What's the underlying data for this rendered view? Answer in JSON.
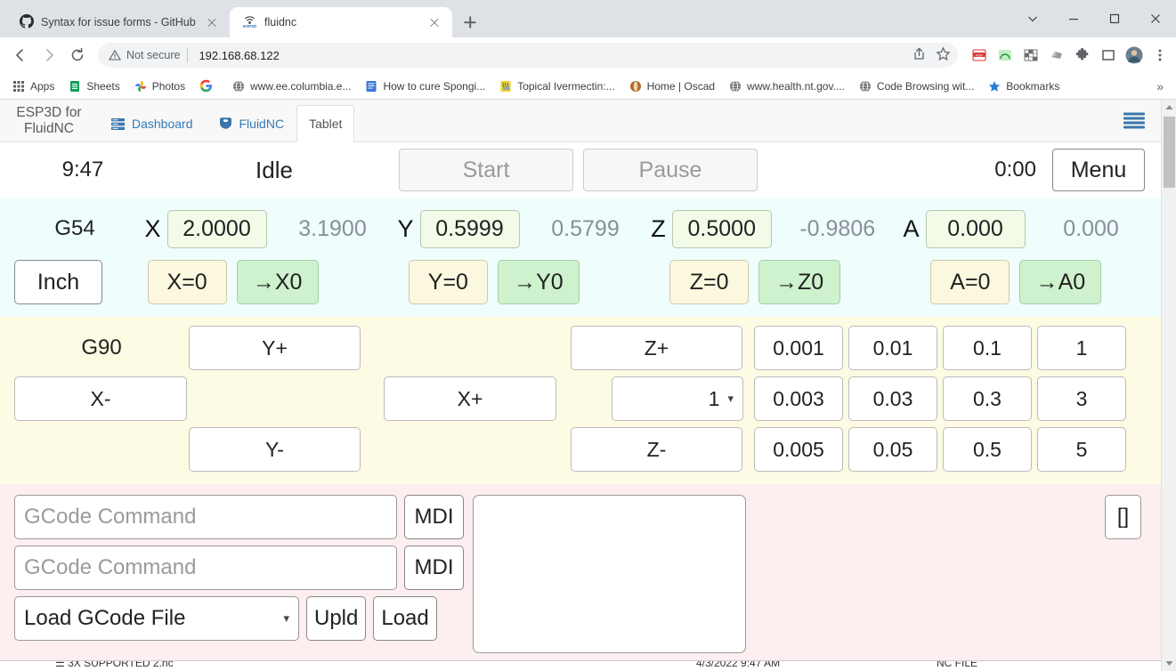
{
  "browser": {
    "tabs": [
      {
        "title": "Syntax for issue forms - GitHub D",
        "icon": "github-icon",
        "active": false
      },
      {
        "title": "fluidnc",
        "icon": "esp3d-favicon",
        "active": true
      }
    ],
    "newtab_label": "+",
    "nav": {
      "back": "back-arrow",
      "forward": "forward-arrow",
      "reload": "reload-icon"
    },
    "omnibox": {
      "security_label": "Not secure",
      "url": "192.168.68.122",
      "share_icon": "share-icon",
      "star_icon": "star-icon"
    },
    "toolbar_icons": [
      "pdf-extension-icon",
      "green-arc-extension-icon",
      "grid-extension-icon",
      "stone-extension-icon",
      "puzzle-extensions-icon",
      "sidepanel-icon",
      "profile-avatar",
      "three-dot-menu-icon"
    ],
    "bookmarks": [
      {
        "label": "Apps",
        "icon": "apps-grid-icon"
      },
      {
        "label": "Sheets",
        "icon": "sheets-icon"
      },
      {
        "label": "Photos",
        "icon": "photos-icon"
      },
      {
        "label": "",
        "icon": "google-g-icon"
      },
      {
        "label": "www.ee.columbia.e...",
        "icon": "globe-icon"
      },
      {
        "label": "How to cure Spongi...",
        "icon": "blue-doc-icon"
      },
      {
        "label": "Topical Ivermectin:...",
        "icon": "yellow-doc-icon"
      },
      {
        "label": "Home | Oscad",
        "icon": "oscad-icon"
      },
      {
        "label": "www.health.nt.gov....",
        "icon": "globe-icon"
      },
      {
        "label": "Code Browsing wit...",
        "icon": "globe-icon"
      },
      {
        "label": "Bookmarks",
        "icon": "star-blue-icon"
      }
    ],
    "bookmarks_overflow": "»",
    "window_controls": [
      "minimize",
      "restore",
      "close"
    ],
    "chevron_window": "chevron-down-icon"
  },
  "app": {
    "brand_line1": "ESP3D for",
    "brand_line2": "FluidNC",
    "tabs": [
      {
        "label": "Dashboard",
        "icon": "server-stack-icon",
        "current": false
      },
      {
        "label": "FluidNC",
        "icon": "fluidnc-logo-icon",
        "current": false
      },
      {
        "label": "Tablet",
        "icon": "",
        "current": true
      }
    ],
    "menu_icon": "hamburger-menu-icon"
  },
  "status": {
    "clock": "9:47",
    "state": "Idle",
    "start_label": "Start",
    "pause_label": "Pause",
    "elapsed": "0:00",
    "menu_label": "Menu"
  },
  "dro": {
    "wcs": "G54",
    "units_label": "Inch",
    "axes": [
      {
        "name": "X",
        "work": "2.0000",
        "machine": "3.1900",
        "zero_label": "X=0",
        "goto_label": "→X0"
      },
      {
        "name": "Y",
        "work": "0.5999",
        "machine": "0.5799",
        "zero_label": "Y=0",
        "goto_label": "→Y0"
      },
      {
        "name": "Z",
        "work": "0.5000",
        "machine": "-0.9806",
        "zero_label": "Z=0",
        "goto_label": "→Z0"
      },
      {
        "name": "A",
        "work": "0.000",
        "machine": "0.000",
        "zero_label": "A=0",
        "goto_label": "→A0"
      }
    ]
  },
  "jog": {
    "mode_label": "G90",
    "y_plus": "Y+",
    "y_minus": "Y-",
    "x_plus": "X+",
    "x_minus": "X-",
    "z_plus": "Z+",
    "z_minus": "Z-",
    "speed_selected": "1",
    "distances": [
      [
        "0.001",
        "0.003",
        "0.005"
      ],
      [
        "0.01",
        "0.03",
        "0.05"
      ],
      [
        "0.1",
        "0.3",
        "0.5"
      ],
      [
        "1",
        "3",
        "5"
      ]
    ]
  },
  "gcode": {
    "cmd1_placeholder": "GCode Command",
    "cmd1_value": "",
    "cmd2_placeholder": "GCode Command",
    "cmd2_value": "",
    "mdi1_label": "MDI",
    "mdi2_label": "MDI",
    "file_select_value": "Load GCode File",
    "upld_label": "Upld",
    "load_label": "Load",
    "brackets_label": "[]",
    "console_value": ""
  },
  "colors": {
    "dro_bg": "#effdfd",
    "jog_bg": "#fdfbe3",
    "gcode_bg": "#fdeef0",
    "zero_btn": "#fcf8df",
    "goto_btn": "#cdf2cd",
    "dro_value_bg": "#f1fbe8",
    "accent_blue": "#337ab7"
  }
}
